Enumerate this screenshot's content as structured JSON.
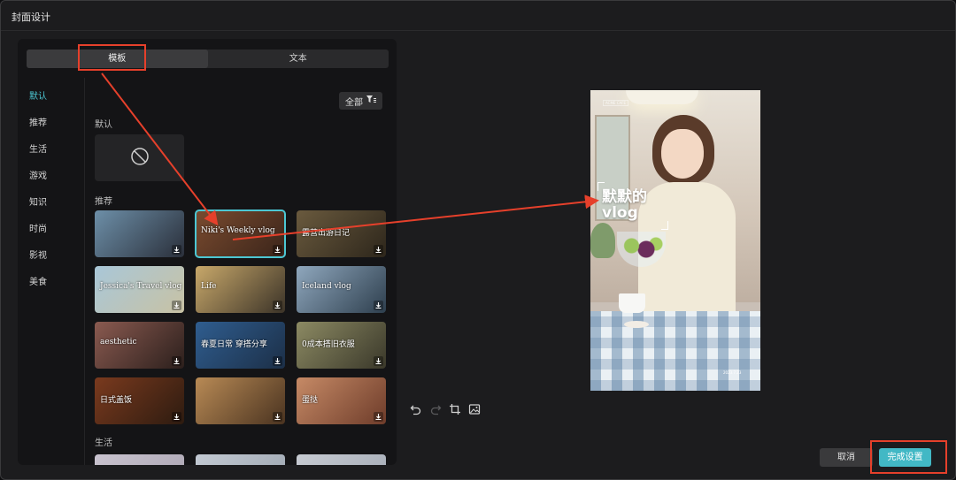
{
  "dialog": {
    "title": "封面设计"
  },
  "tabs": [
    {
      "label": "模板",
      "active": true
    },
    {
      "label": "文本",
      "active": false
    }
  ],
  "categories": [
    {
      "label": "默认",
      "active": true
    },
    {
      "label": "推荐"
    },
    {
      "label": "生活"
    },
    {
      "label": "游戏"
    },
    {
      "label": "知识"
    },
    {
      "label": "时尚"
    },
    {
      "label": "影视"
    },
    {
      "label": "美食"
    }
  ],
  "filter": {
    "label": "全部"
  },
  "sections": {
    "default": "默认",
    "recommend": "推荐",
    "life": "生活"
  },
  "templates": [
    {
      "text": "",
      "colors": [
        "#6d8fa8",
        "#2a2f3a"
      ]
    },
    {
      "text": "Niki's Weekly vlog",
      "colors": [
        "#7a4b2f",
        "#3a241a"
      ],
      "selected": true
    },
    {
      "text": "露营出游日记",
      "colors": [
        "#6a5a3e",
        "#2d261b"
      ]
    },
    {
      "text": "Jessica's Travel vlog",
      "colors": [
        "#a9c7d8",
        "#c8c2a4"
      ]
    },
    {
      "text": "Life",
      "colors": [
        "#c8a86a",
        "#3b3328"
      ]
    },
    {
      "text": "Iceland vlog",
      "colors": [
        "#8fa7bd",
        "#2e3f4e"
      ]
    },
    {
      "text": "aesthetic",
      "colors": [
        "#8a5a50",
        "#2b1f1c"
      ]
    },
    {
      "text": "春夏日常 穿搭分享",
      "colors": [
        "#2f5d8f",
        "#1c2f47"
      ]
    },
    {
      "text": "0成本搭旧衣服",
      "colors": [
        "#8c8a63",
        "#3a382a"
      ]
    },
    {
      "text": "日式盖饭",
      "colors": [
        "#7a3a1e",
        "#2d1b10"
      ]
    },
    {
      "text": "",
      "colors": [
        "#b88a55",
        "#4a3320"
      ]
    },
    {
      "text": "蛋挞",
      "colors": [
        "#c68a66",
        "#6e3c2a"
      ]
    },
    {
      "text": "",
      "colors": [
        "#c9c3cf",
        "#a9a3b0"
      ]
    },
    {
      "text": "",
      "colors": [
        "#c3cad3",
        "#9aa3ad"
      ]
    },
    {
      "text": "",
      "colors": [
        "#c7cbd2",
        "#a1a8b3"
      ]
    }
  ],
  "preview": {
    "title_line1": "默默的",
    "title_line2": "vlog",
    "date": "2023.7.23",
    "brand": "ACME CAFE"
  },
  "toolbar": {
    "undo_icon": "undo-icon",
    "redo_icon": "redo-icon",
    "crop_icon": "crop-icon",
    "image_icon": "replace-image-icon"
  },
  "buttons": {
    "cancel": "取消",
    "done": "完成设置"
  },
  "colors": {
    "accent": "#4cc7d3",
    "primary_button": "#42b8c5",
    "annotation": "#e6402b"
  }
}
